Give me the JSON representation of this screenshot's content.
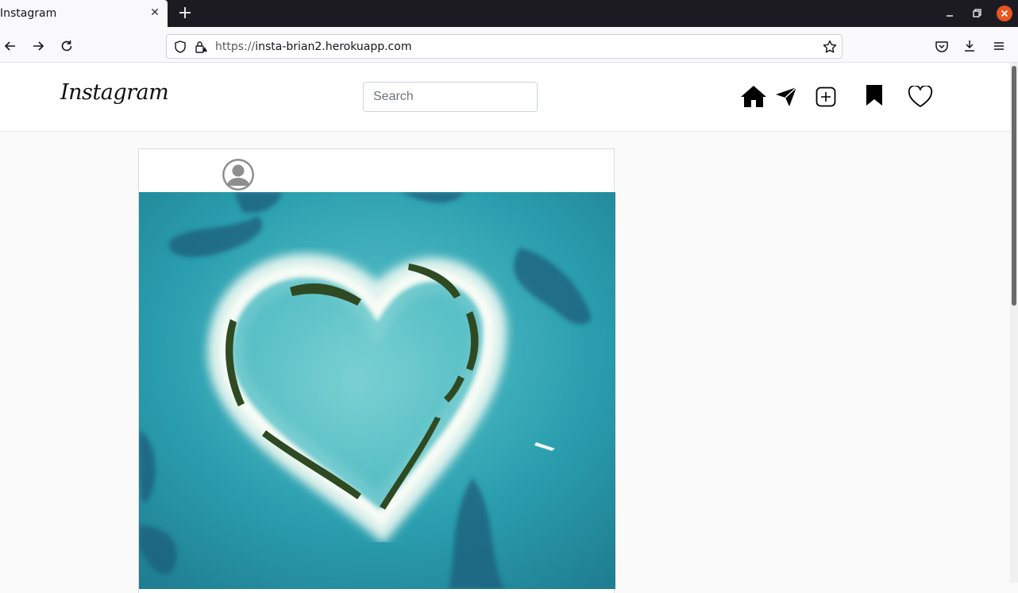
{
  "browser": {
    "tab_title": "Instagram",
    "url_scheme": "https://",
    "url_host": "insta-brian2.herokuapp.com"
  },
  "app": {
    "logo": "Instagram",
    "search_placeholder": "Search"
  },
  "colors": {
    "window_close": "#e95420",
    "ocean": "#2f9fae"
  }
}
